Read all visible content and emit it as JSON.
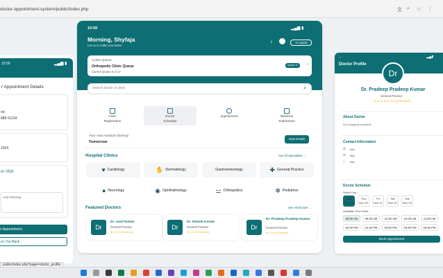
{
  "browser": {
    "url": "doctor-appointment-system/public/index.php",
    "status_url": "public/index.php?page=doctor_profile"
  },
  "left": {
    "time": "10:59",
    "title": "r Appointment Details",
    "tag": "nic",
    "phone": "888 01234",
    "date": "2024",
    "visit": "or Visit",
    "visit_value": "",
    "note": "eral checkup",
    "btn_book": "n Appointment",
    "btn_cancel": "el / Go Back"
  },
  "home": {
    "time": "10:59",
    "greeting": "Morning, Shyfaja",
    "subtitle": "Let us to make you better",
    "logout": "Logout",
    "queue": {
      "label": "Active Queue",
      "name": "Orthopedic Clinic Queue",
      "current": "Current Queue 5 of 17",
      "badge": "Queue 6"
    },
    "search_placeholder": "Search doctor or clinic",
    "services": [
      {
        "l1": "Clinic",
        "l2": "Registration"
      },
      {
        "l1": "Doctor",
        "l2": "Schedule"
      },
      {
        "l1": "Appointment",
        "l2": ""
      },
      {
        "l1": "Medicine",
        "l2": "Submission"
      }
    ],
    "checkup": {
      "label": "Your next medical checkup",
      "value": "Tomorrow",
      "btn": "View Details"
    },
    "clinics_title": "Hospital Clinics",
    "clinics_link": "See All Specialties →",
    "clinics": [
      "Cardiology",
      "Dermatology",
      "Gastroenterology",
      "General Practice",
      "Neurology",
      "Ophthalmology",
      "Orthopedics",
      "Pediatrics"
    ],
    "featured_title": "Featured Doctors",
    "featured_link": "See All Doctors →",
    "doctors": [
      {
        "initials": "Dr",
        "name": "Dr. sunil kumar",
        "spec": "General Practice",
        "rating": "★ 4.5 (0 Reviews)"
      },
      {
        "initials": "Dr",
        "name": "Dr. Dinesh Kumar",
        "spec": "General Practice",
        "rating": "★ 4.5 (0 Reviews)"
      },
      {
        "initials": "Dr",
        "name": "Dr. Pradeep Pradeep Kumar",
        "spec": "General Practice",
        "rating": "★ 4.5 (0 Reviews)"
      }
    ]
  },
  "profile": {
    "title": "Doctor Profile",
    "initials": "Dr",
    "name": "Dr. Pradeep Pradeep Kumar",
    "spec": "General Practice",
    "rating": "★ ★ ★ ★ ★ 4.5 (0 Reviews)",
    "about_title": "About Doctor",
    "about": "No biography available.",
    "contact_title": "Contact Information",
    "contact": [
      "N/A",
      "N/A",
      "N/A"
    ],
    "schedule_title": "Doctor Schedule",
    "select_day": "Select Day:",
    "days": [
      {
        "d": "Wed",
        "n": "Nov 19"
      },
      {
        "d": "Thu",
        "n": "Nov 20"
      },
      {
        "d": "Fri",
        "n": "Nov 21"
      },
      {
        "d": "Sat",
        "n": "Nov 22"
      },
      {
        "d": "Sun",
        "n": "Nov 23"
      }
    ],
    "slots_title": "Available Time Slots:",
    "slots": [
      "09:00 AM",
      "09:30 AM",
      "10:00 AM",
      "10:30 AM",
      "11:00 AM",
      "02:00 PM",
      "02:30 PM",
      "03:00 PM",
      "03:30 PM",
      "04:00 PM"
    ],
    "book": "Book Appointment"
  },
  "colors": {
    "primary": "#0d6e73",
    "accent": "#f2b01e"
  }
}
